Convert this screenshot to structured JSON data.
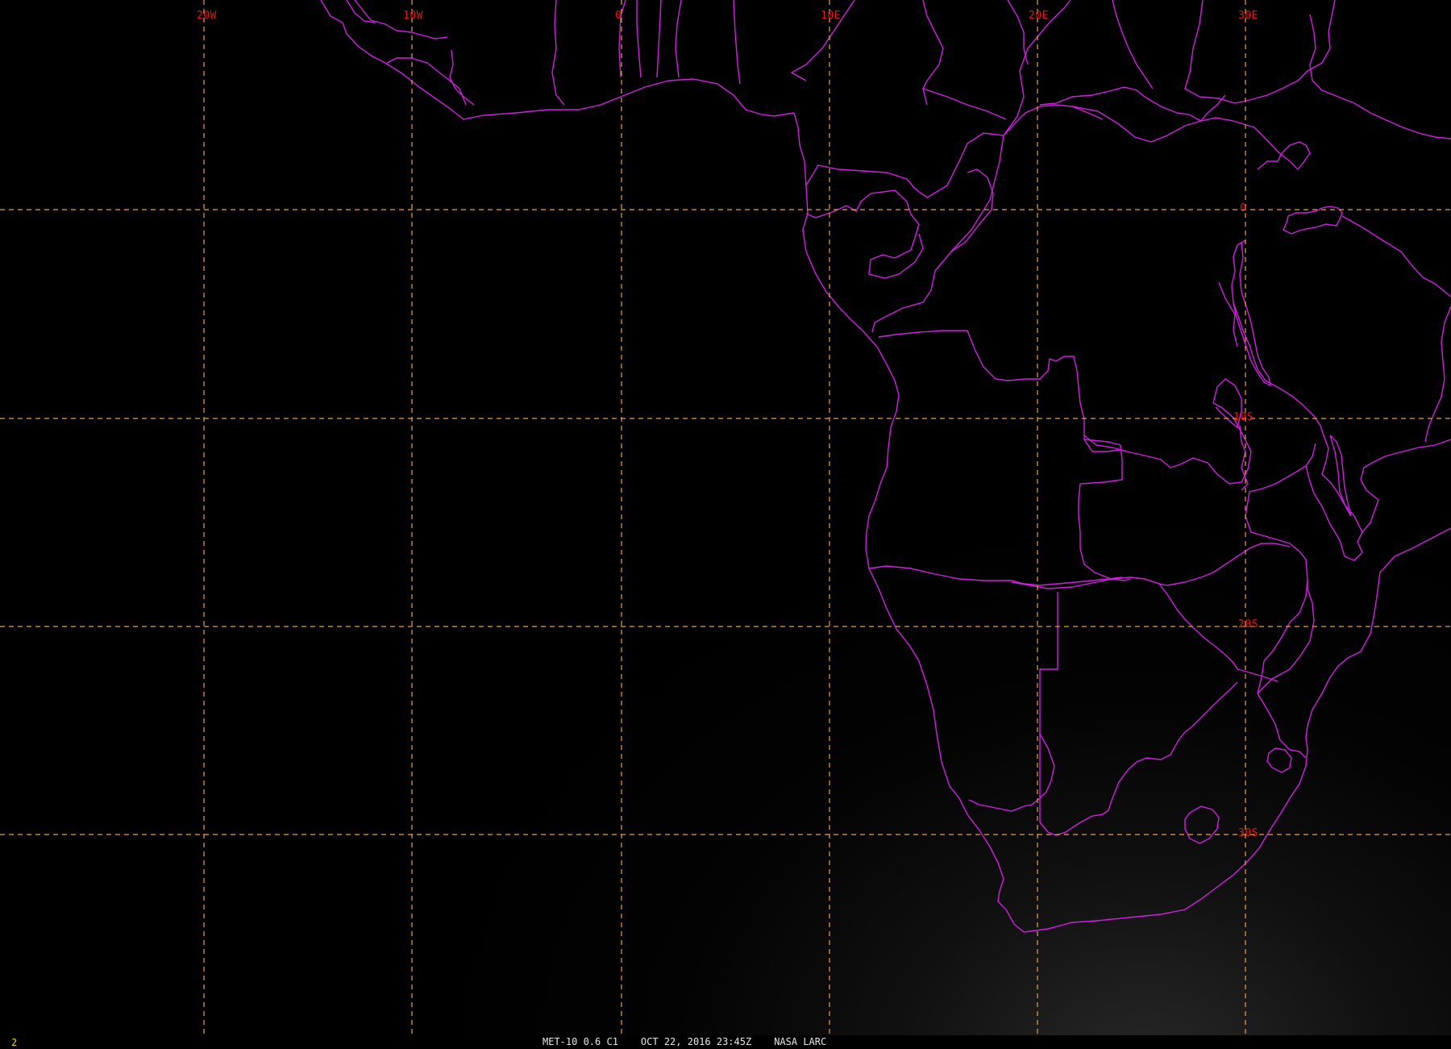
{
  "map": {
    "grid_color": "#e8a050",
    "coast_color": "#d020e0",
    "label_color": "#e01818",
    "longitude_labels": [
      "20W",
      "10W",
      "0",
      "10E",
      "20E",
      "30E"
    ],
    "latitude_labels": [
      "0",
      "10S",
      "20S",
      "30S"
    ]
  },
  "status": {
    "frame_number": "2",
    "frame_color": "#e8d020",
    "satellite": "MET-10 0.6 C1",
    "datetime": "OCT 22, 2016 23:45Z",
    "source": "NASA LARC"
  }
}
